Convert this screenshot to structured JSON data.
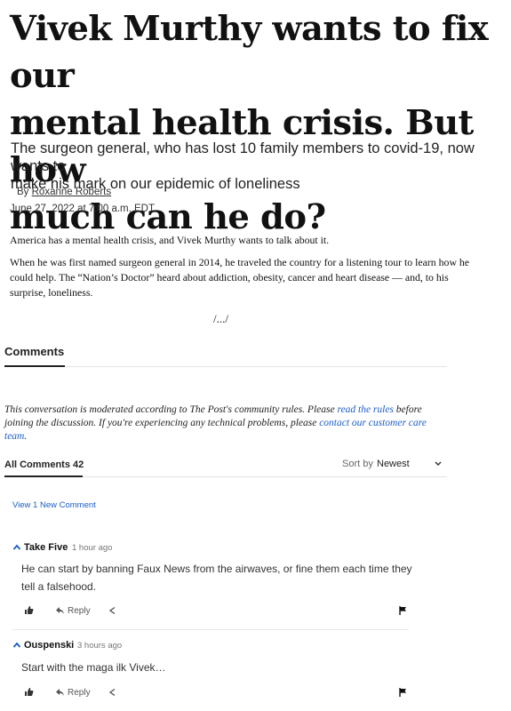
{
  "article": {
    "headline_line1": "Vivek Murthy wants to fix our",
    "headline_line2": "mental health crisis. But how",
    "headline_line3": "much can he do?",
    "dek_line1": "The surgeon general, who has lost 10 family members to covid-19, now wants to",
    "dek_line2": "make his mark on our epidemic of loneliness",
    "byline_prefix": "By",
    "author": "Roxanne Roberts",
    "date": "June 27, 2022 at 7:00 a.m. EDT",
    "para1": "America has a mental health crisis, and Vivek Murthy wants to talk about it.",
    "para2_line1": "When he was first named surgeon general in 2014, he traveled the country for a listening tour to learn how he",
    "para2_line2": "could help. The “Nation’s Doctor” heard about addiction, obesity, cancer and heart disease — and, to his",
    "para2_line3": "surprise, loneliness.",
    "truncation": "/.../"
  },
  "comments": {
    "tab_label": "Comments",
    "moderation_text_1": "This conversation is moderated according to The Post's community rules. Please ",
    "read_rules_link": "read the rules",
    "moderation_text_2": " before joining the discussion. If you're experiencing any technical problems, please ",
    "contact_link": "contact our customer care team",
    "moderation_text_3": ".",
    "all_comments_label": "All Comments",
    "all_comments_count": "42",
    "sort_label": "Sort by",
    "sort_value": "Newest",
    "view_new": "View 1 New Comment",
    "reply_label": "Reply",
    "items": [
      {
        "author": "Take Five",
        "time": "1 hour ago",
        "body_line1": "He can start by banning Faux News from the airwaves, or fine them each time they",
        "body_line2": "tell a falsehood."
      },
      {
        "author": "Ouspenski",
        "time": "3 hours ago",
        "body_line1": "Start with the maga ilk Vivek…",
        "body_line2": ""
      }
    ]
  },
  "colors": {
    "link_blue": "#1a5cc8",
    "caret_blue": "#1a5cc8"
  },
  "icons": [
    "chevron-up-icon",
    "thumbs-up-icon",
    "reply-arrow-icon",
    "share-icon",
    "flag-icon",
    "chevron-down-icon"
  ]
}
